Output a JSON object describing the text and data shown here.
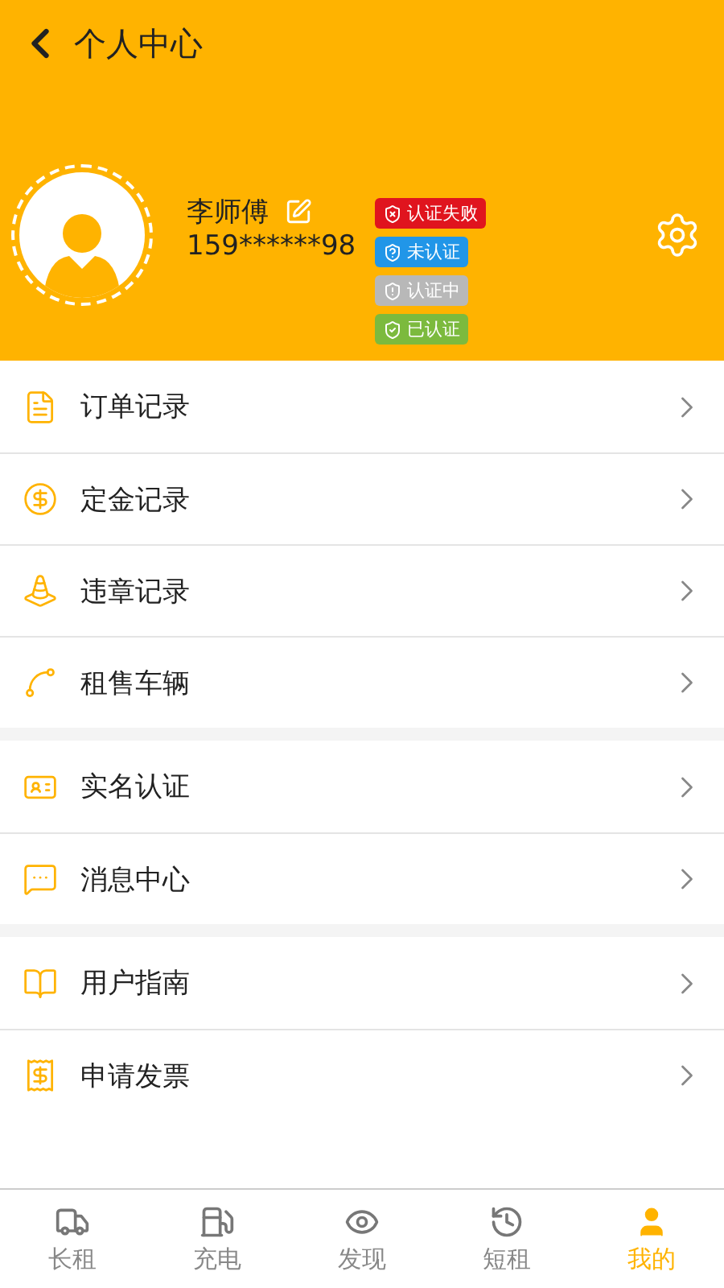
{
  "header": {
    "title": "个人中心"
  },
  "profile": {
    "name": "李师傅",
    "phone": "159******98",
    "badges": [
      {
        "kind": "failed",
        "label": "认证失败",
        "color": "#e0141e"
      },
      {
        "kind": "unverified",
        "label": "未认证",
        "color": "#2196e8"
      },
      {
        "kind": "pending",
        "label": "认证中",
        "color": "#b8b8b8"
      },
      {
        "kind": "verified",
        "label": "已认证",
        "color": "#7cba3e"
      }
    ]
  },
  "menu_groups": [
    {
      "items": [
        {
          "kind": "order",
          "label": "订单记录"
        },
        {
          "kind": "deposit",
          "label": "定金记录"
        },
        {
          "kind": "violation",
          "label": "违章记录"
        },
        {
          "kind": "vehicle",
          "label": "租售车辆"
        }
      ]
    },
    {
      "items": [
        {
          "kind": "identity",
          "label": "实名认证"
        },
        {
          "kind": "message",
          "label": "消息中心"
        }
      ]
    },
    {
      "items": [
        {
          "kind": "guide",
          "label": "用户指南"
        },
        {
          "kind": "invoice",
          "label": "申请发票"
        }
      ]
    }
  ],
  "tab_bar": [
    {
      "kind": "truck",
      "label": "长租",
      "selected": false
    },
    {
      "kind": "charge",
      "label": "充电",
      "selected": false
    },
    {
      "kind": "eye",
      "label": "发现",
      "selected": false
    },
    {
      "kind": "history",
      "label": "短租",
      "selected": false
    },
    {
      "kind": "user",
      "label": "我的",
      "selected": true
    }
  ]
}
